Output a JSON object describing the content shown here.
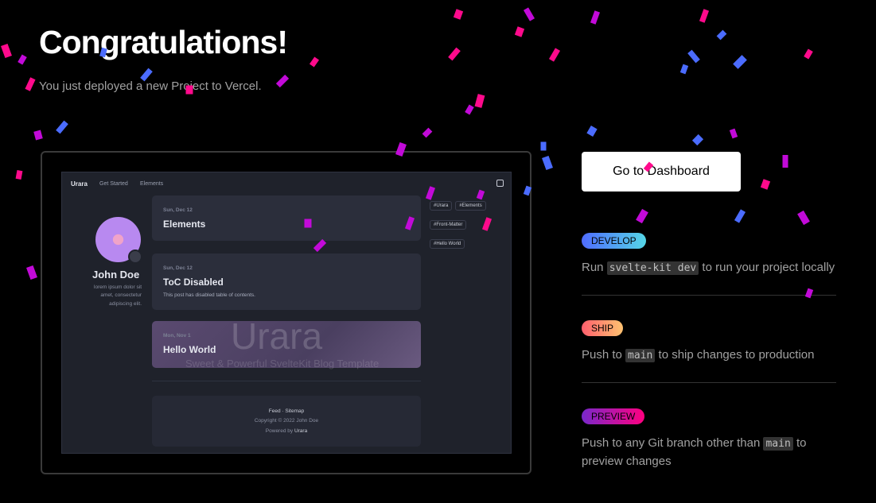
{
  "header": {
    "title": "Congratulations!",
    "subtitle": "You just deployed a new Project to Vercel."
  },
  "preview": {
    "nav": {
      "brand": "Urara",
      "links": [
        "Get Started",
        "Elements"
      ]
    },
    "profile": {
      "name": "John Doe",
      "bio": "lorem ipsum dolor sit amet, consectetur adipiscing elit."
    },
    "posts": [
      {
        "date": "Sun, Dec 12",
        "title": "Elements",
        "desc": ""
      },
      {
        "date": "Sun, Dec 12",
        "title": "ToC Disabled",
        "desc": "This post has disabled table of contents."
      },
      {
        "date": "Mon, Nov 1",
        "title": "Hello World",
        "watermark": "Urara",
        "watermark_sub": "Sweet & Powerful SvelteKit Blog Template"
      }
    ],
    "tags": [
      "#Urara",
      "#Elements",
      "#Front-Matter",
      "#Hello World"
    ],
    "footer": {
      "links": "Feed · Sitemap",
      "copyright": "Copyright © 2022 John Doe",
      "powered_prefix": "Powered by ",
      "powered_by": "Urara"
    }
  },
  "actions": {
    "dashboard_label": "Go to Dashboard"
  },
  "steps": [
    {
      "label": "DEVELOP",
      "before": "Run ",
      "code": "svelte-kit dev",
      "after": " to run your project locally"
    },
    {
      "label": "SHIP",
      "before": "Push to ",
      "code": "main",
      "after": " to ship changes to production"
    },
    {
      "label": "PREVIEW",
      "before": "Push to any Git branch other than ",
      "code": "main",
      "after": " to preview changes"
    }
  ],
  "colors": {
    "confetti": [
      "#ff0a8c",
      "#c20ad8",
      "#4b6cff"
    ],
    "background": "#000000"
  }
}
